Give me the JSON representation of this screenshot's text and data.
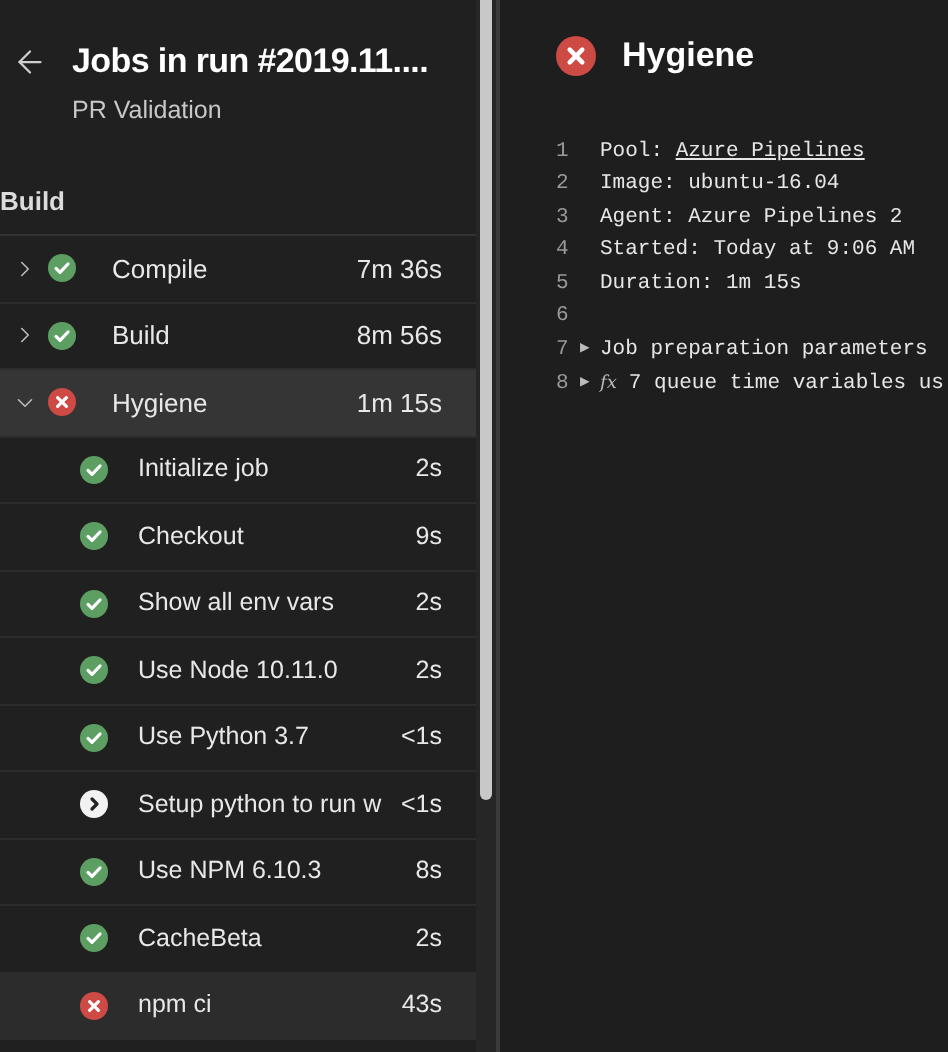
{
  "header": {
    "title": "Jobs in run #2019.11....",
    "subtitle": "PR Validation"
  },
  "stage": {
    "name": "Build"
  },
  "jobs": [
    {
      "name": "Compile",
      "kind": "success",
      "duration": "7m 36s",
      "expanded": false,
      "selected": false
    },
    {
      "name": "Build",
      "kind": "success",
      "duration": "8m 56s",
      "expanded": false,
      "selected": false
    },
    {
      "name": "Hygiene",
      "kind": "failed",
      "duration": "1m 15s",
      "expanded": true,
      "selected": true,
      "steps": [
        {
          "name": "Initialize job",
          "kind": "success",
          "duration": "2s",
          "selected": false
        },
        {
          "name": "Checkout",
          "kind": "success",
          "duration": "9s",
          "selected": false
        },
        {
          "name": "Show all env vars",
          "kind": "success",
          "duration": "2s",
          "selected": false
        },
        {
          "name": "Use Node 10.11.0",
          "kind": "success",
          "duration": "2s",
          "selected": false
        },
        {
          "name": "Use Python 3.7",
          "kind": "success",
          "duration": "<1s",
          "selected": false
        },
        {
          "name": "Setup python to run w",
          "kind": "skipped",
          "duration": "<1s",
          "selected": false
        },
        {
          "name": "Use NPM 6.10.3",
          "kind": "success",
          "duration": "8s",
          "selected": false
        },
        {
          "name": "CacheBeta",
          "kind": "success",
          "duration": "2s",
          "selected": false
        },
        {
          "name": "npm ci",
          "kind": "failed",
          "duration": "43s",
          "selected": true
        }
      ]
    }
  ],
  "detail": {
    "kind": "failed",
    "title": "Hygiene",
    "log": [
      {
        "number": "1",
        "kind": "link",
        "text": "Pool: ",
        "link": "Azure Pipelines"
      },
      {
        "number": "2",
        "kind": "text",
        "text": "Image: ubuntu-16.04"
      },
      {
        "number": "3",
        "kind": "text",
        "text": "Agent: Azure Pipelines 2"
      },
      {
        "number": "4",
        "kind": "text",
        "text": "Started: Today at 9:06 AM"
      },
      {
        "number": "5",
        "kind": "text",
        "text": "Duration: 1m 15s"
      },
      {
        "number": "6",
        "kind": "blank"
      },
      {
        "number": "7",
        "kind": "expander",
        "arrow": "▶",
        "text": "Job preparation parameters"
      },
      {
        "number": "8",
        "kind": "variables",
        "arrow": "▶",
        "fx": "fx",
        "text": "7 queue time variables us"
      }
    ]
  }
}
